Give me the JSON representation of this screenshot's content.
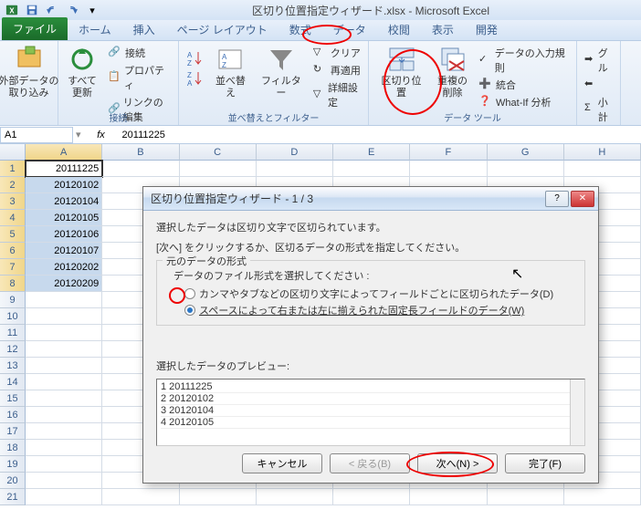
{
  "title": "区切り位置指定ウィザード.xlsx - Microsoft Excel",
  "tabs": {
    "file": "ファイル",
    "home": "ホーム",
    "insert": "挿入",
    "layout": "ページ レイアウト",
    "formulas": "数式",
    "data": "データ",
    "review": "校閲",
    "view": "表示",
    "developer": "開発"
  },
  "ribbon": {
    "ext_data": "外部データの\n取り込み",
    "refresh": "すべて\n更新",
    "conn": "接続",
    "props": "プロパティ",
    "editlinks": "リンクの編集",
    "conn_group": "接続",
    "sort": "並べ替え",
    "filter": "フィルター",
    "clear": "クリア",
    "reapply": "再適用",
    "advanced": "詳細設定",
    "sortfilter_group": "並べ替えとフィルター",
    "texttocol": "区切り位置",
    "removedup": "重複の\n削除",
    "datavalid": "データの入力規則",
    "consolidate": "統合",
    "whatif": "What-If 分析",
    "datatools_group": "データ ツール",
    "group_btn": "グル",
    "subtotal": "小計"
  },
  "formula_bar": {
    "name": "A1",
    "fx": "fx",
    "value": "20111225"
  },
  "columns": [
    "A",
    "B",
    "C",
    "D",
    "E",
    "F",
    "G",
    "H"
  ],
  "rows": [
    "1",
    "2",
    "3",
    "4",
    "5",
    "6",
    "7",
    "8",
    "9",
    "10",
    "11",
    "12",
    "13",
    "14",
    "15",
    "16",
    "17",
    "18",
    "19",
    "20",
    "21"
  ],
  "cells": {
    "a1": "20111225",
    "a2": "20120102",
    "a3": "20120104",
    "a4": "20120105",
    "a5": "20120106",
    "a6": "20120107",
    "a7": "20120202",
    "a8": "20120209"
  },
  "dialog": {
    "title": "区切り位置指定ウィザード - 1 / 3",
    "line1": "選択したデータは区切り文字で区切られています。",
    "line2": "[次へ] をクリックするか、区切るデータの形式を指定してください。",
    "group_title": "元のデータの形式",
    "group_sub": "データのファイル形式を選択してください :",
    "radio1": "カンマやタブなどの区切り文字によってフィールドごとに区切られたデータ(D)",
    "radio2": "スペースによって右または左に揃えられた固定長フィールドのデータ(W)",
    "preview_label": "選択したデータのプレビュー:",
    "preview": [
      "1 20111225",
      "2 20120102",
      "3 20120104",
      "4 20120105"
    ],
    "btn_cancel": "キャンセル",
    "btn_back": "< 戻る(B)",
    "btn_next": "次へ(N) >",
    "btn_finish": "完了(F)"
  }
}
